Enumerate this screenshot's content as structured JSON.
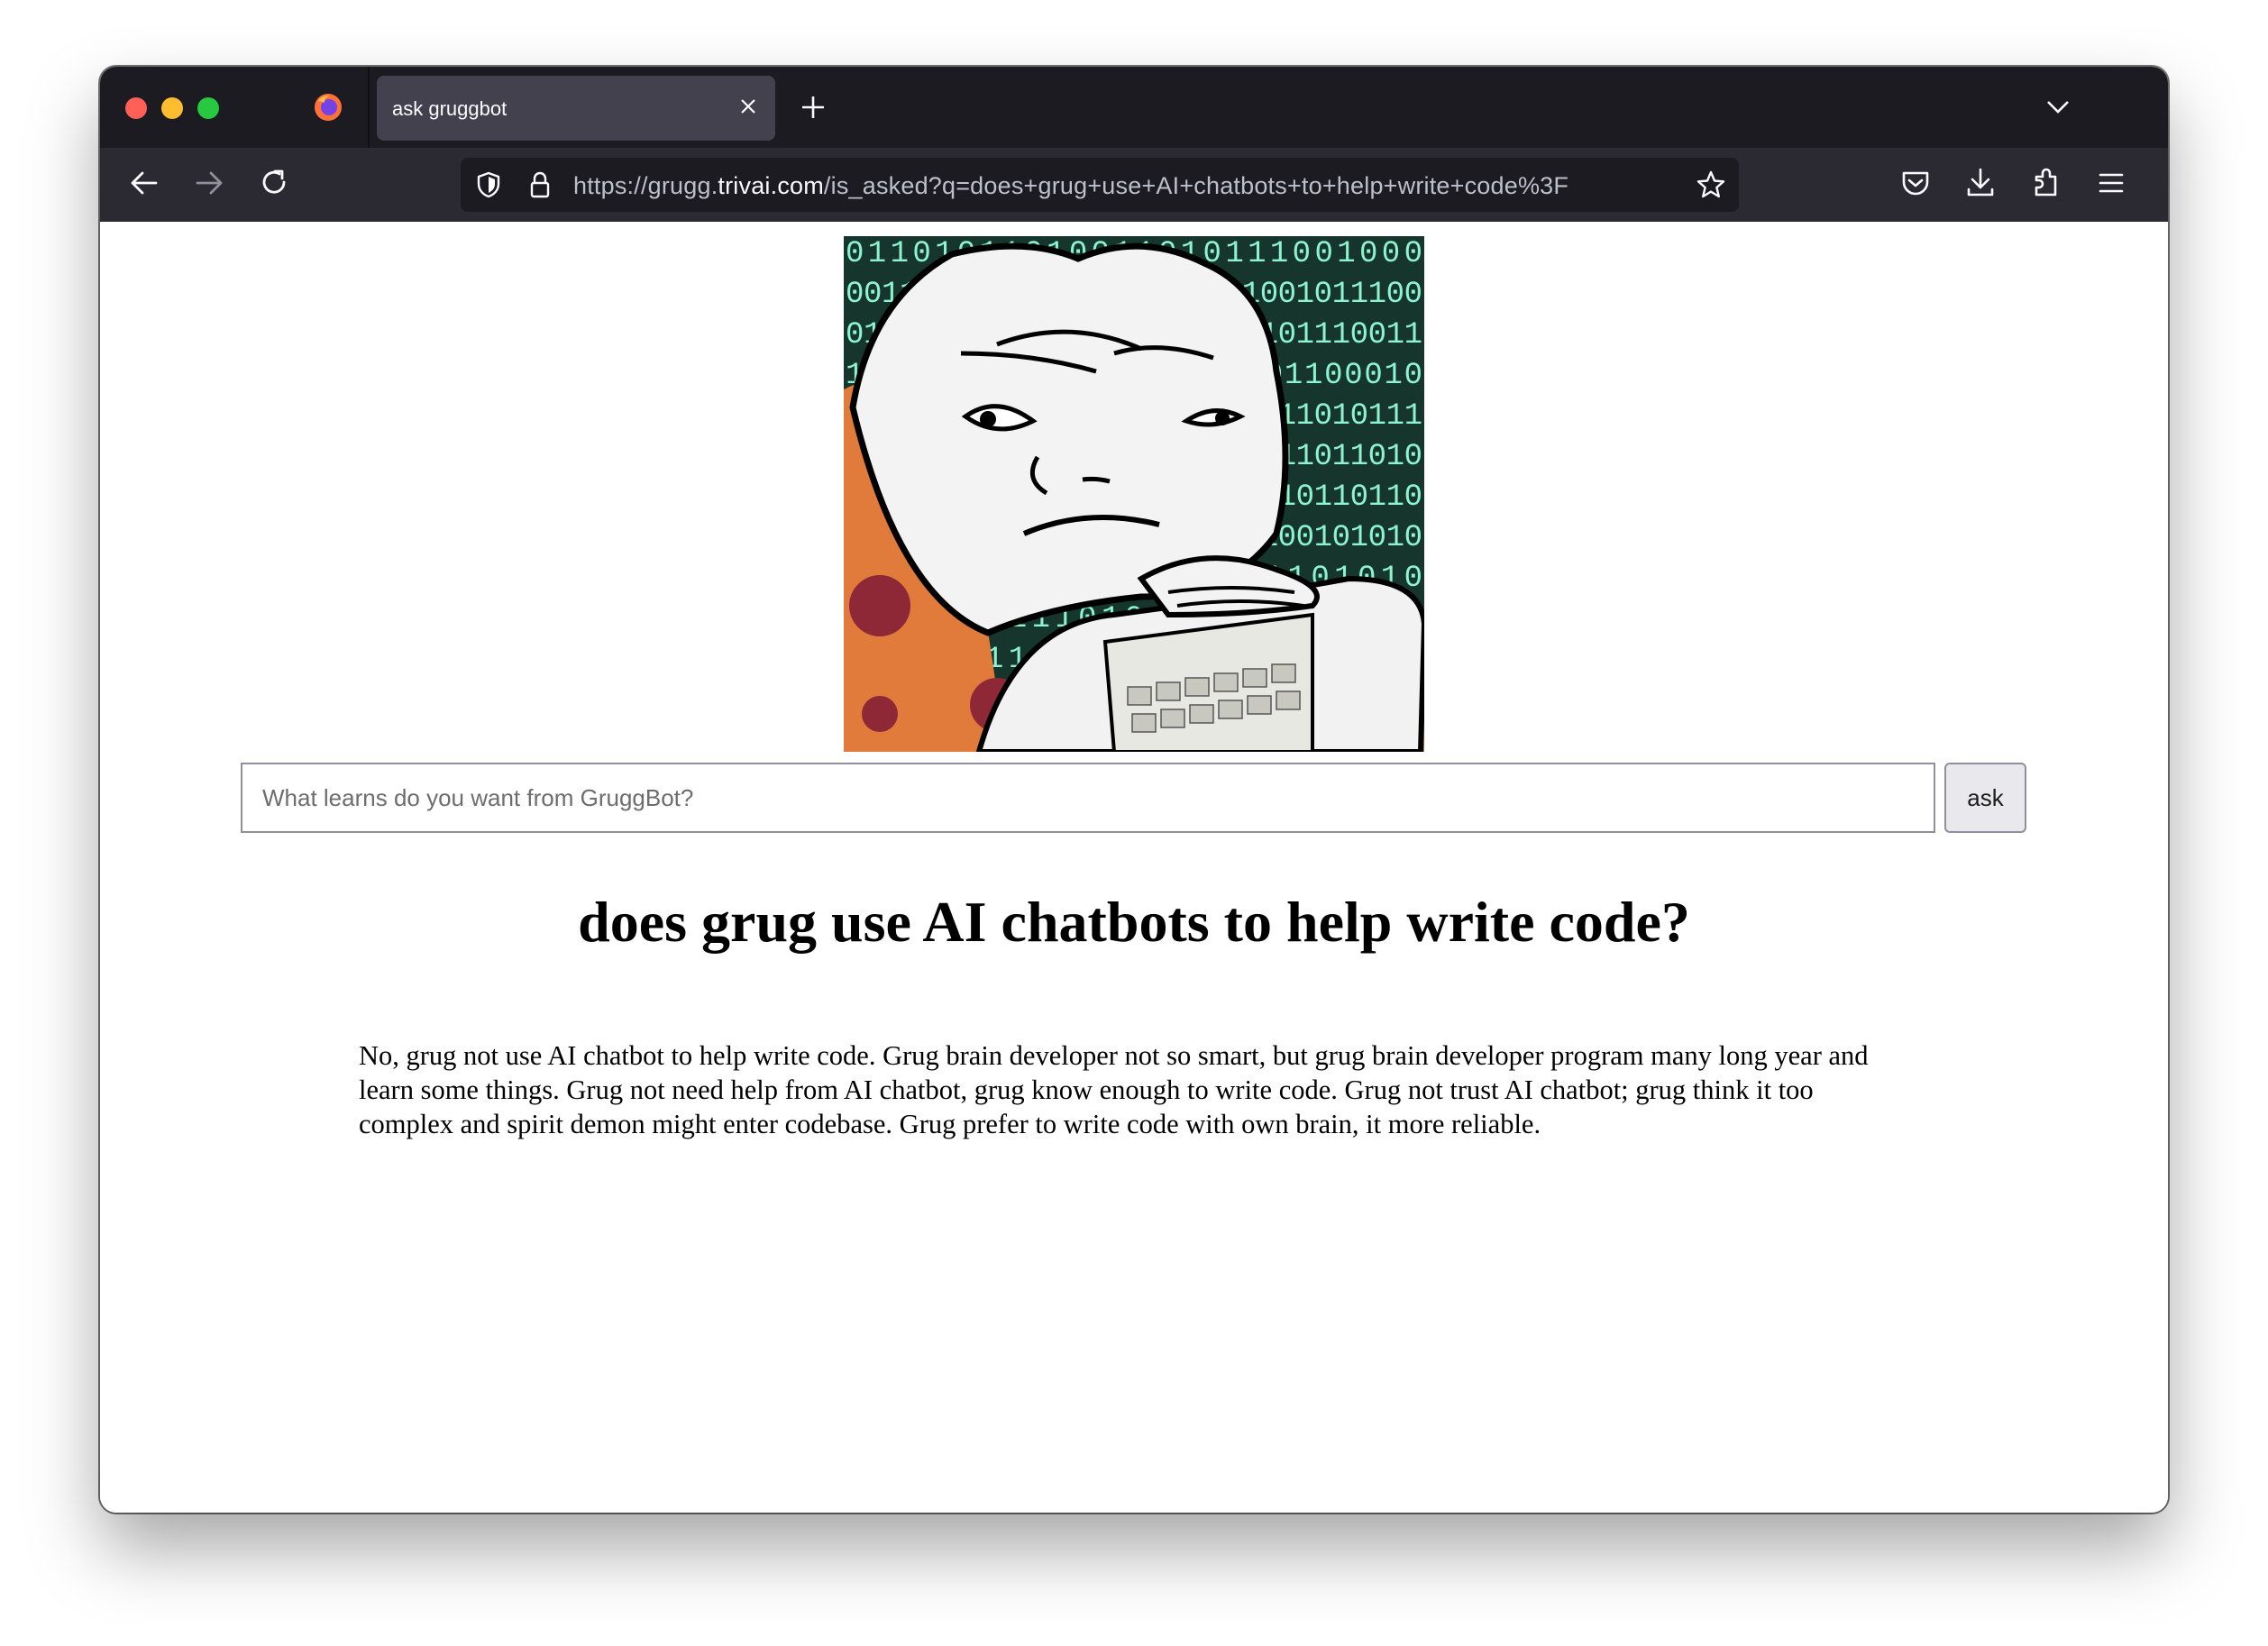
{
  "browser": {
    "tab_title": "ask gruggbot",
    "url_prefix": "https://grugg.",
    "url_domain": "trivai.com",
    "url_path": "/is_asked?q=does+grug+use+AI+chatbots+to+help+write+code%3F"
  },
  "hero": {
    "binary_rows": [
      "01101011010011010111001000",
      "00110101011001001100111001011100",
      "01110111011110011001101101110011",
      "10010110101101101001101100010",
      "01011001110011010011110111010111",
      "10100110001100110101110011011010",
      "10110001111010111100110110110110",
      "10110101101101001011001100101010",
      "1101001101011010101101010",
      "1011010111010110101011010",
      "0110101101011010110101101",
      "1010110101101011010110101"
    ]
  },
  "search": {
    "placeholder": "What learns do you want from GruggBot?",
    "button_label": "ask"
  },
  "question": "does grug use AI chatbots to help write code?",
  "answer": "No, grug not use AI chatbot to help write code. Grug brain developer not so smart, but grug brain developer program many long year and learn some things. Grug not need help from AI chatbot, grug know enough to write code. Grug not trust AI chatbot; grug think it too complex and spirit demon might enter codebase. Grug prefer to write code with own brain, it more reliable."
}
